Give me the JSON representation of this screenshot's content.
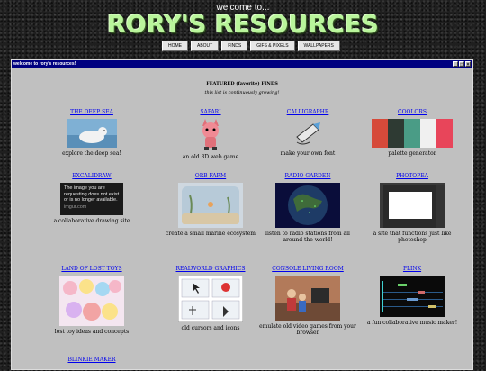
{
  "header": {
    "welcome": "welcome to...",
    "logo": "RORY'S RESOURCES"
  },
  "nav": [
    "HOME",
    "ABOUT",
    "FINDS",
    "GIFS & PIXELS",
    "WALLPAPERS"
  ],
  "window": {
    "title": "welcome to rory's resources!",
    "controls": [
      "_",
      "□",
      "×"
    ]
  },
  "content": {
    "featured": "FEATURED (favorite) FINDS",
    "growing": "this list is continuously growing!",
    "items": [
      {
        "title": "THE DEEP SEA",
        "desc": "explore the deep sea!"
      },
      {
        "title": "SAPARI",
        "desc": "an old 3D web game"
      },
      {
        "title": "CALLIGRAPHR",
        "desc": "make your own font"
      },
      {
        "title": "COOLORS",
        "desc": "palette generator"
      },
      {
        "title": "EXCALIDRAW",
        "desc": "a collaborative drawing site",
        "notice": [
          "The image you are",
          "requesting does not exist",
          "or is no longer available.",
          "imgur.com"
        ]
      },
      {
        "title": "ORB FARM",
        "desc": "create a small marine ecosystem"
      },
      {
        "title": "RADIO GARDEN",
        "desc": "listen to radio stations from all around the world!"
      },
      {
        "title": "PHOTOPEA",
        "desc": "a site that functions just like photoshop"
      },
      {
        "title": "LAND OF LOST TOYS",
        "desc": "lost toy ideas and concepts"
      },
      {
        "title": "REALWORLD GRAPHICS",
        "desc": "old cursors and icons"
      },
      {
        "title": "CONSOLE LIVING ROOM",
        "desc": "emulate old video games from your browser"
      },
      {
        "title": "PLINK",
        "desc": "a fun collaborative music maker!"
      },
      {
        "title": "BLINKIE MAKER",
        "desc": ""
      }
    ]
  },
  "colors": {
    "titlebar": "#000080",
    "window_bg": "#c0c0c0",
    "logo_green": "#b9f59b",
    "link": "#0000ee"
  }
}
